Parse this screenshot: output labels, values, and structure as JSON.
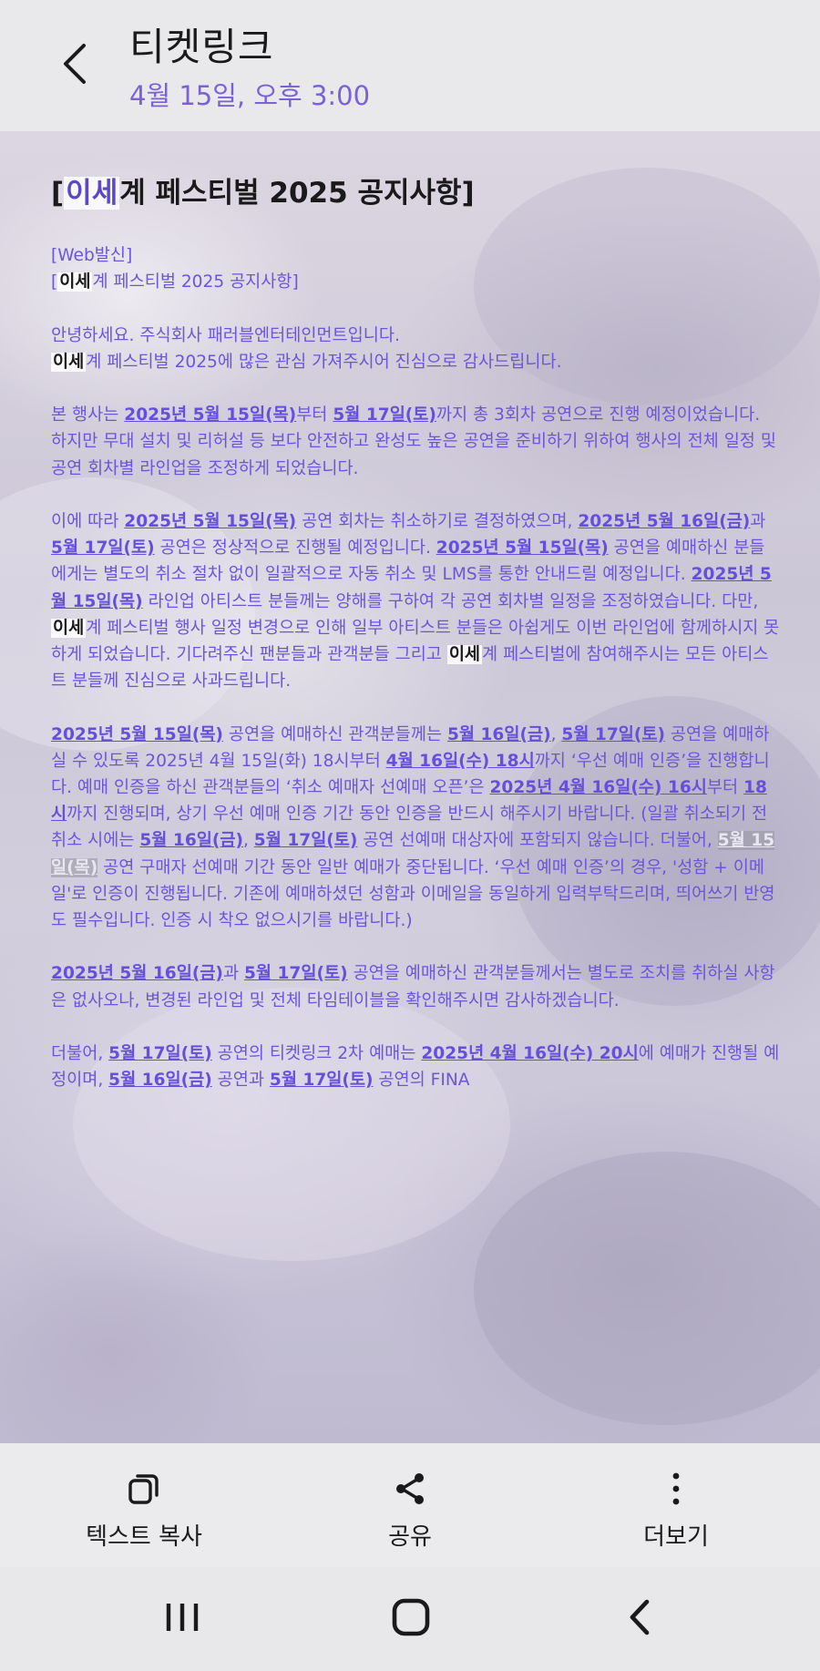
{
  "header": {
    "title": "티켓링크",
    "date": "4월 15일, 오후 3:00"
  },
  "message": {
    "title_hl": "이세",
    "title_rest": "계 페스티벌 2025 공지사항]",
    "title_open": "[",
    "l1": "[Web발신]",
    "l2_open": "[",
    "isekai": "이세",
    "l2_rest": "계 페스티벌 2025 공지사항]",
    "p1a": "안녕하세요. 주식회사 패러블엔터테인먼트입니다.",
    "p1b_rest": "계 페스티벌 2025에 많은 관심 가져주시어 진심으로 감사드립니다.",
    "p2": {
      "t1": "본 행사는 ",
      "d1": "2025년 5월 15일(목)",
      "t2": "부터 ",
      "d2": "5월 17일(토)",
      "t3": "까지 총 3회차 공연으로 진행 예정이었습니다. 하지만 무대 설치 및 리허설 등 보다 안전하고 완성도 높은 공연을 준비하기 위하여 행사의 전체 일정 및 공연 회차별 라인업을 조정하게 되었습니다."
    },
    "p3": {
      "t1": "이에 따라 ",
      "d1": "2025년 5월 15일(목)",
      "t2": " 공연 회차는 취소하기로 결정하였으며, ",
      "d2": "2025년 5월 16일(금)",
      "t3": "과 ",
      "d3": "5월 17일(토)",
      "t4": " 공연은 정상적으로 진행될 예정입니다. ",
      "d4": "2025년 5월 15일(목)",
      "t5": " 공연을 예매하신 분들에게는 별도의 취소 절차 없이 일괄적으로 자동 취소 및 LMS를 통한 안내드릴 예정입니다. ",
      "d5": "2025년 5월 15일(목)",
      "t6": " 라인업 아티스트 분들께는 양해를 구하여 각 공연 회차별 일정을 조정하였습니다. 다만, ",
      "t7": "계 페스티벌 행사 일정 변경으로 인해 일부 아티스트 분들은 아쉽게도 이번 라인업에 함께하시지 못하게 되었습니다. 기다려주신 팬분들과 관객분들 그리고 ",
      "t8": "계 페스티벌에 참여해주시는 모든 아티스트 분들께 진심으로 사과드립니다."
    },
    "p4": {
      "d1": "2025년 5월 15일(목)",
      "t1": " 공연을 예매하신 관객분들께는 ",
      "d2": "5월 16일(금)",
      "t2": ", ",
      "d3": "5월 17일(토)",
      "t3": " 공연을 예매하실 수 있도록 2025년 4월 15일(화) 18시부터 ",
      "d4": "4월 16일(수) 18시",
      "t4": "까지 ‘우선 예매 인증’을 진행합니다. 예매 인증을 하신 관객분들의 ‘취소 예매자 선예매 오픈’은 ",
      "d5": "2025년 4월 16일(수) 16시",
      "t5": "부터 ",
      "d6": "18시",
      "t6": "까지 진행되며, 상기 우선 예매 인증 기간 동안 인증을 반드시 해주시기 바랍니다. (일괄 취소되기 전 취소 시에는 ",
      "d7": "5월 16일(금)",
      "t7": ", ",
      "d8": "5월 17일(토)",
      "t8": " 공연 선예매 대상자에 포함되지 않습니다. 더불어, ",
      "d9": "5월 15일(목)",
      "t9": " 공연 구매자 선예매 기간 동안 일반 예매가 중단됩니다. ‘우선 예매 인증’의 경우, '성함 + 이메일'로 인증이 진행됩니다. 기존에 예매하셨던 성함과 이메일을 동일하게 입력부탁드리며, 띄어쓰기 반영도 필수입니다. 인증 시 착오 없으시기를 바랍니다.)"
    },
    "p5": {
      "d1": "2025년 5월 16일(금)",
      "t1": "과 ",
      "d2": "5월 17일(토)",
      "t2": " 공연을 예매하신 관객분들께서는 별도로 조치를 취하실 사항은 없사오나, 변경된 라인업 및 전체 타임테이블을 확인해주시면 감사하겠습니다."
    },
    "p6": {
      "t1": "더불어, ",
      "d1": "5월 17일(토)",
      "t2": " 공연의 티켓링크 2차 예매는 ",
      "d2": "2025년 4월 16일(수) 20시",
      "t3": "에 예매가 진행될 예정이며, ",
      "d3": "5월 16일(금)",
      "t4": " 공연과 ",
      "d4": "5월 17일(토)",
      "t5": " 공연의 FINA"
    }
  },
  "actions": {
    "copy": "텍스트 복사",
    "share": "공유",
    "more": "더보기"
  },
  "icons": {
    "back": "back-arrow-icon",
    "copy": "copy-icon",
    "share": "share-icon",
    "more": "more-vertical-icon",
    "recents": "recents-icon",
    "home": "home-icon",
    "nav_back": "nav-back-icon"
  },
  "colors": {
    "accent": "#6a56d8",
    "date": "#7a62d6"
  }
}
